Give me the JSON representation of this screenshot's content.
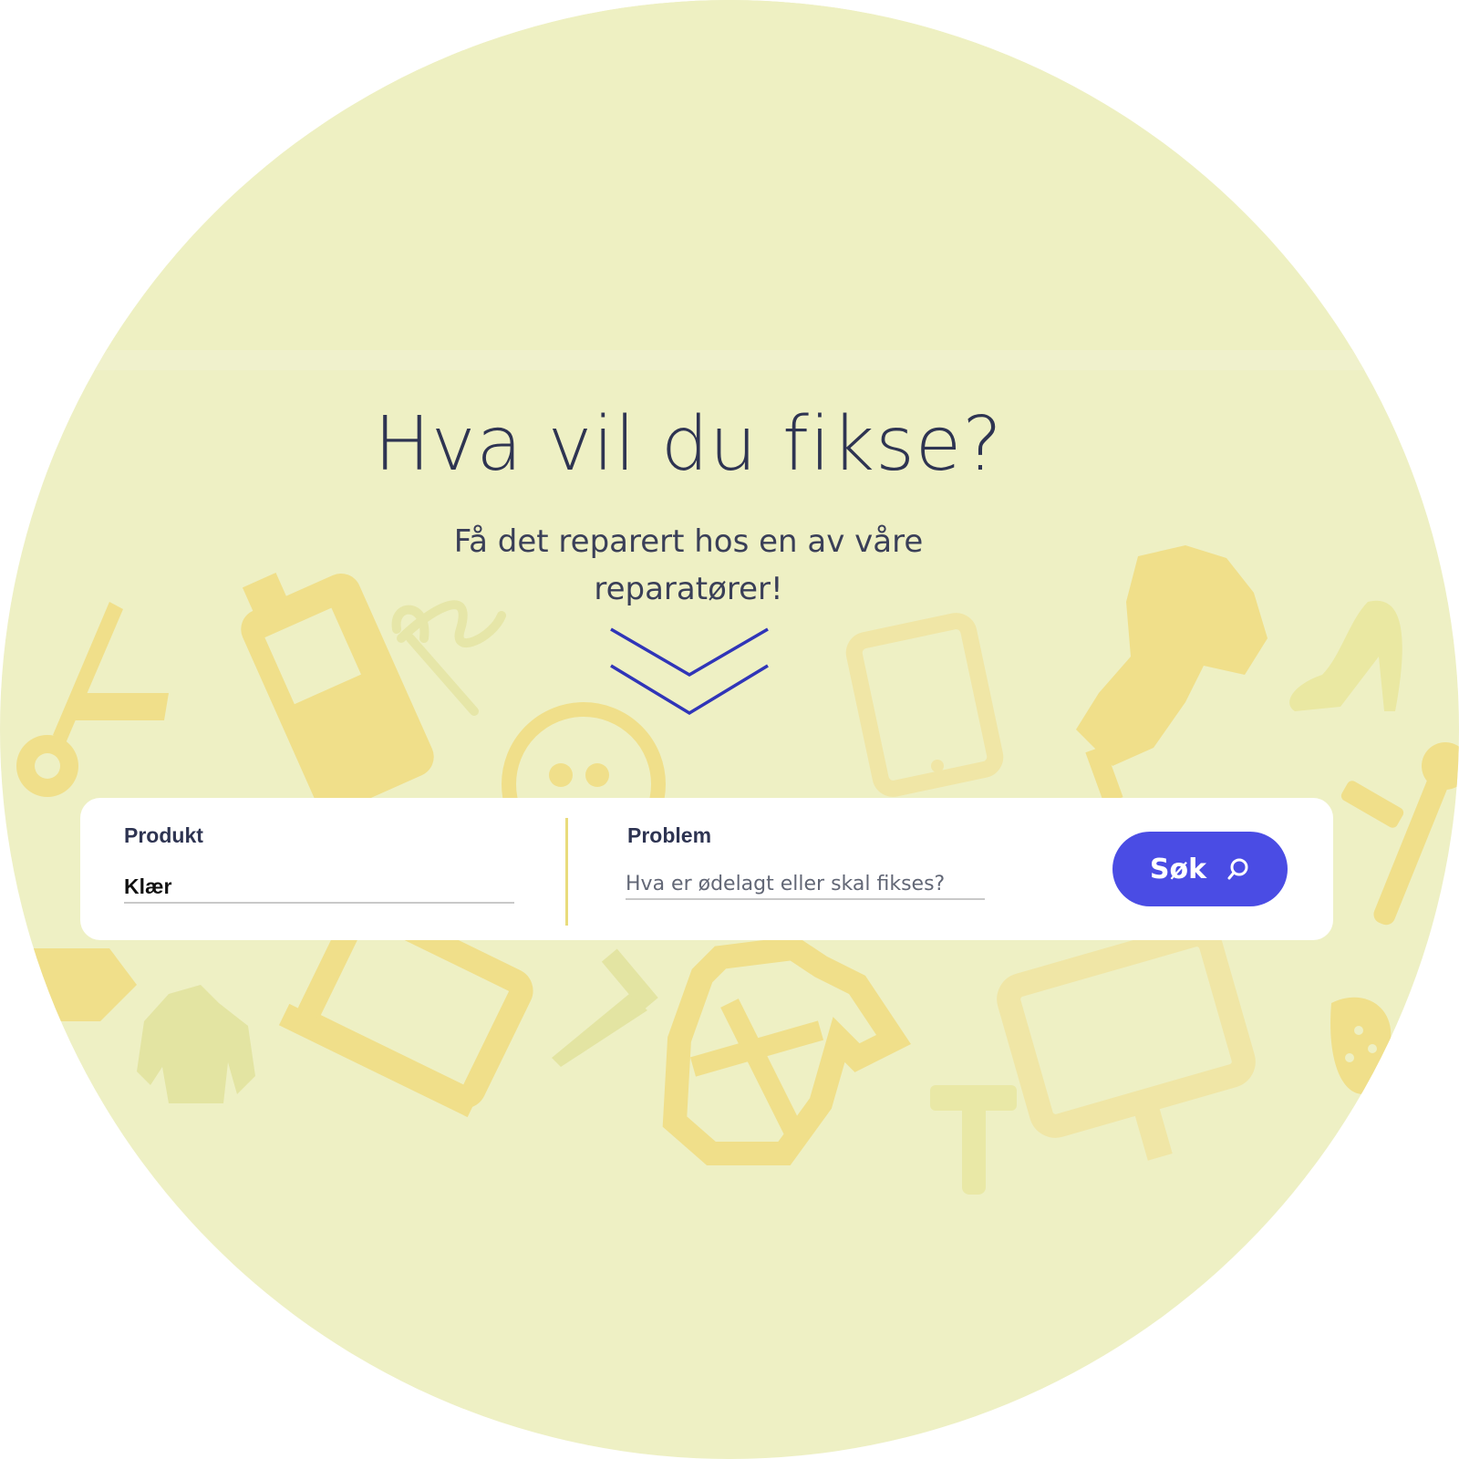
{
  "hero": {
    "title": "Hva vil du fikse?",
    "subtitle": "Få det reparert hos en av våre reparatører!"
  },
  "search": {
    "product_label": "Produkt",
    "product_value": "Klær",
    "problem_label": "Problem",
    "problem_placeholder": "Hva er ødelagt eller skal fikses?",
    "button_label": "Søk"
  },
  "colors": {
    "background": "#eef0c4",
    "icon_yellow": "#f0df8a",
    "heading": "#2e3452",
    "chevron": "#3035b8",
    "button": "#4a4ce4"
  },
  "icons": {
    "chevron": "double-chevron-down-icon",
    "search": "search-icon",
    "background": [
      "scissors-icon",
      "mobile-phone-icon",
      "needle-thread-icon",
      "button-icon",
      "tablet-icon",
      "dress-form-icon",
      "high-heel-icon",
      "bike-pump-icon",
      "jacket-icon",
      "laptop-icon",
      "nail-icon",
      "shirt-icon",
      "hammer-icon",
      "monitor-icon",
      "hair-dryer-icon"
    ]
  }
}
